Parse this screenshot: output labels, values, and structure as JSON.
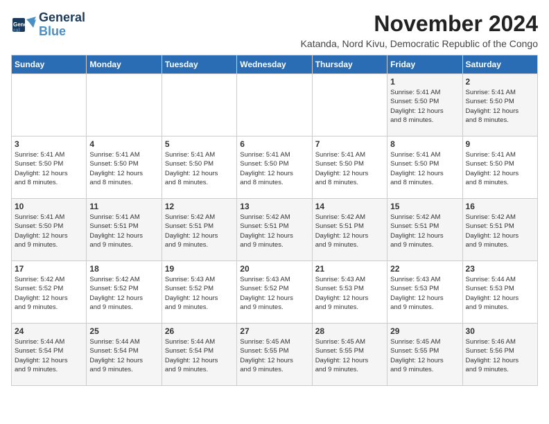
{
  "logo": {
    "line1": "General",
    "line2": "Blue"
  },
  "title": "November 2024",
  "location": "Katanda, Nord Kivu, Democratic Republic of the Congo",
  "weekdays": [
    "Sunday",
    "Monday",
    "Tuesday",
    "Wednesday",
    "Thursday",
    "Friday",
    "Saturday"
  ],
  "weeks": [
    [
      {
        "day": "",
        "info": ""
      },
      {
        "day": "",
        "info": ""
      },
      {
        "day": "",
        "info": ""
      },
      {
        "day": "",
        "info": ""
      },
      {
        "day": "",
        "info": ""
      },
      {
        "day": "1",
        "info": "Sunrise: 5:41 AM\nSunset: 5:50 PM\nDaylight: 12 hours\nand 8 minutes."
      },
      {
        "day": "2",
        "info": "Sunrise: 5:41 AM\nSunset: 5:50 PM\nDaylight: 12 hours\nand 8 minutes."
      }
    ],
    [
      {
        "day": "3",
        "info": "Sunrise: 5:41 AM\nSunset: 5:50 PM\nDaylight: 12 hours\nand 8 minutes."
      },
      {
        "day": "4",
        "info": "Sunrise: 5:41 AM\nSunset: 5:50 PM\nDaylight: 12 hours\nand 8 minutes."
      },
      {
        "day": "5",
        "info": "Sunrise: 5:41 AM\nSunset: 5:50 PM\nDaylight: 12 hours\nand 8 minutes."
      },
      {
        "day": "6",
        "info": "Sunrise: 5:41 AM\nSunset: 5:50 PM\nDaylight: 12 hours\nand 8 minutes."
      },
      {
        "day": "7",
        "info": "Sunrise: 5:41 AM\nSunset: 5:50 PM\nDaylight: 12 hours\nand 8 minutes."
      },
      {
        "day": "8",
        "info": "Sunrise: 5:41 AM\nSunset: 5:50 PM\nDaylight: 12 hours\nand 8 minutes."
      },
      {
        "day": "9",
        "info": "Sunrise: 5:41 AM\nSunset: 5:50 PM\nDaylight: 12 hours\nand 8 minutes."
      }
    ],
    [
      {
        "day": "10",
        "info": "Sunrise: 5:41 AM\nSunset: 5:50 PM\nDaylight: 12 hours\nand 9 minutes."
      },
      {
        "day": "11",
        "info": "Sunrise: 5:41 AM\nSunset: 5:51 PM\nDaylight: 12 hours\nand 9 minutes."
      },
      {
        "day": "12",
        "info": "Sunrise: 5:42 AM\nSunset: 5:51 PM\nDaylight: 12 hours\nand 9 minutes."
      },
      {
        "day": "13",
        "info": "Sunrise: 5:42 AM\nSunset: 5:51 PM\nDaylight: 12 hours\nand 9 minutes."
      },
      {
        "day": "14",
        "info": "Sunrise: 5:42 AM\nSunset: 5:51 PM\nDaylight: 12 hours\nand 9 minutes."
      },
      {
        "day": "15",
        "info": "Sunrise: 5:42 AM\nSunset: 5:51 PM\nDaylight: 12 hours\nand 9 minutes."
      },
      {
        "day": "16",
        "info": "Sunrise: 5:42 AM\nSunset: 5:51 PM\nDaylight: 12 hours\nand 9 minutes."
      }
    ],
    [
      {
        "day": "17",
        "info": "Sunrise: 5:42 AM\nSunset: 5:52 PM\nDaylight: 12 hours\nand 9 minutes."
      },
      {
        "day": "18",
        "info": "Sunrise: 5:42 AM\nSunset: 5:52 PM\nDaylight: 12 hours\nand 9 minutes."
      },
      {
        "day": "19",
        "info": "Sunrise: 5:43 AM\nSunset: 5:52 PM\nDaylight: 12 hours\nand 9 minutes."
      },
      {
        "day": "20",
        "info": "Sunrise: 5:43 AM\nSunset: 5:52 PM\nDaylight: 12 hours\nand 9 minutes."
      },
      {
        "day": "21",
        "info": "Sunrise: 5:43 AM\nSunset: 5:53 PM\nDaylight: 12 hours\nand 9 minutes."
      },
      {
        "day": "22",
        "info": "Sunrise: 5:43 AM\nSunset: 5:53 PM\nDaylight: 12 hours\nand 9 minutes."
      },
      {
        "day": "23",
        "info": "Sunrise: 5:44 AM\nSunset: 5:53 PM\nDaylight: 12 hours\nand 9 minutes."
      }
    ],
    [
      {
        "day": "24",
        "info": "Sunrise: 5:44 AM\nSunset: 5:54 PM\nDaylight: 12 hours\nand 9 minutes."
      },
      {
        "day": "25",
        "info": "Sunrise: 5:44 AM\nSunset: 5:54 PM\nDaylight: 12 hours\nand 9 minutes."
      },
      {
        "day": "26",
        "info": "Sunrise: 5:44 AM\nSunset: 5:54 PM\nDaylight: 12 hours\nand 9 minutes."
      },
      {
        "day": "27",
        "info": "Sunrise: 5:45 AM\nSunset: 5:55 PM\nDaylight: 12 hours\nand 9 minutes."
      },
      {
        "day": "28",
        "info": "Sunrise: 5:45 AM\nSunset: 5:55 PM\nDaylight: 12 hours\nand 9 minutes."
      },
      {
        "day": "29",
        "info": "Sunrise: 5:45 AM\nSunset: 5:55 PM\nDaylight: 12 hours\nand 9 minutes."
      },
      {
        "day": "30",
        "info": "Sunrise: 5:46 AM\nSunset: 5:56 PM\nDaylight: 12 hours\nand 9 minutes."
      }
    ]
  ]
}
